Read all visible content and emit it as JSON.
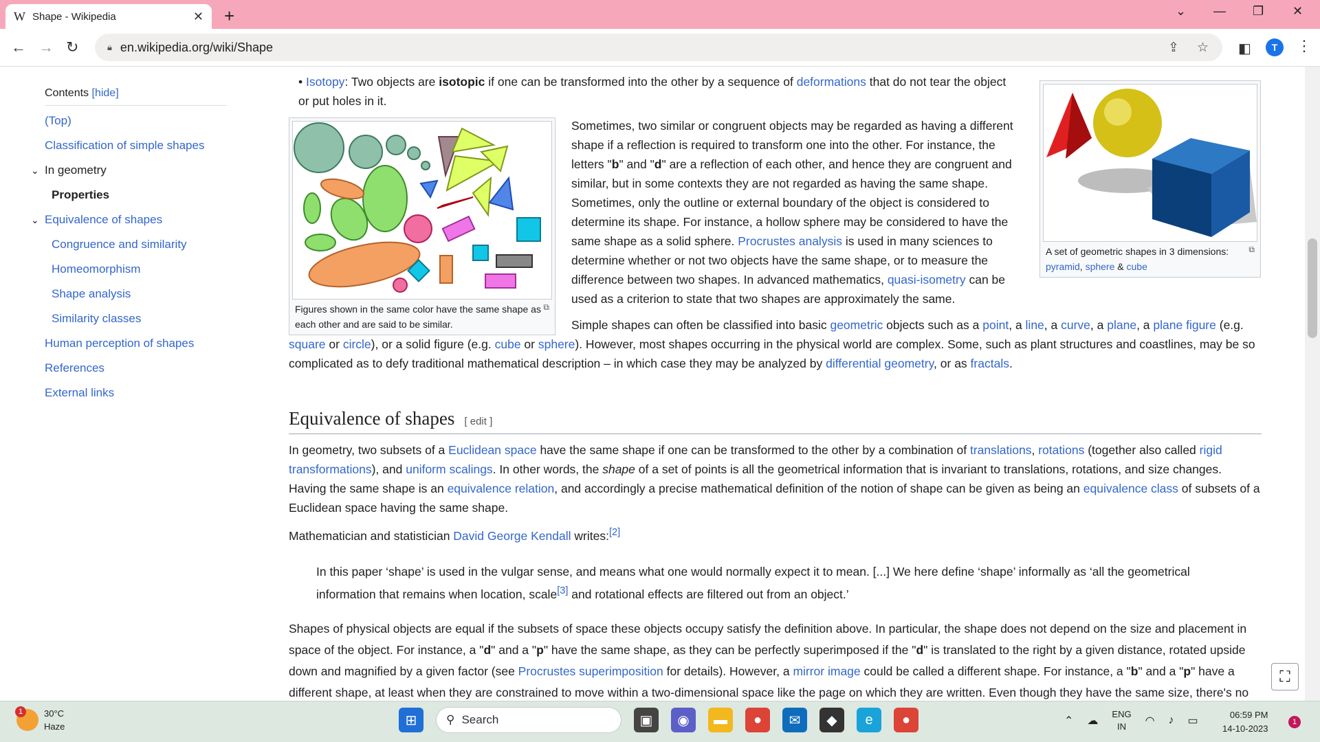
{
  "browser": {
    "tab_title": "Shape - Wikipedia",
    "tab_icon": "W",
    "url": "en.wikipedia.org/wiki/Shape",
    "profile_initial": "T",
    "accent": "#f6a8ba"
  },
  "toc": {
    "heading": "Contents",
    "hide": "[hide]",
    "items": [
      {
        "label": "(Top)"
      },
      {
        "label": "Classification of simple shapes"
      },
      {
        "label": "In geometry"
      },
      {
        "label": "Properties"
      },
      {
        "label": "Equivalence of shapes"
      },
      {
        "label": "Congruence and similarity"
      },
      {
        "label": "Homeomorphism"
      },
      {
        "label": "Shape analysis"
      },
      {
        "label": "Similarity classes"
      },
      {
        "label": "Human perception of shapes"
      },
      {
        "label": "References"
      },
      {
        "label": "External links"
      }
    ]
  },
  "article": {
    "isotopy": {
      "link": "Isotopy",
      "t1": ": Two objects are ",
      "bold": "isotopic",
      "t2": " if one can be transformed into the other by a sequence of ",
      "link2": "deformations",
      "t3": " that do not tear the object or put holes in it."
    },
    "fig_left_caption": "Figures shown in the same color have the same shape as each other and are said to be similar.",
    "fig_right_caption": "A set of geometric shapes in 3 dimensions: ",
    "fig_right_links": [
      "pyramid",
      "sphere",
      "cube"
    ],
    "fig_right_amp": " & ",
    "fig_right_comma": ", ",
    "p1a": "Sometimes, two similar or congruent objects may be regarded as having a different shape if a reflection is required to transform one into the other. For instance, the letters \"",
    "p1b": "b",
    "p1c": "\" and \"",
    "p1d": "d",
    "p1e": "\" are a reflection of each other, and hence they are congruent and similar, but in some contexts they are not regarded as having the same shape. Sometimes, only the outline or external boundary of the object is considered to determine its shape. For instance, a hollow sphere may be considered to have the same shape as a solid sphere. ",
    "p1_link1": "Procrustes analysis",
    "p1f": " is used in many sciences to determine whether or not two objects have the same shape, or to measure the difference between two shapes. In advanced mathematics, ",
    "p1_link2": "quasi-isometry",
    "p1g": " can be used as a criterion to state that two shapes are approximately the same.",
    "p2a": "Simple shapes can often be classified into basic ",
    "p2_links": [
      "geometric",
      "point",
      "line",
      "curve",
      "plane",
      "plane figure",
      "square",
      "circle",
      "cube",
      "sphere",
      "differential geometry",
      "fractals"
    ],
    "p2_t1": " objects such as a ",
    "p2_t2": ", a ",
    "p2_t3": " (e.g. ",
    "p2_t4": " or ",
    "p2_t5": "), or a solid figure (e.g. ",
    "p2_t6": "). However, most shapes occurring in the physical world are complex. Some, such as plant structures and coastlines, may be so complicated as to defy traditional mathematical description – in which case they may be analyzed by ",
    "p2_t7": ", or as ",
    "p2_t8": ".",
    "h2": "Equivalence of shapes",
    "h2_edit": "[ edit ]",
    "p3a": "In geometry, two subsets of a ",
    "p3_links": [
      "Euclidean space",
      "translations",
      "rotations",
      "rigid transformations",
      "uniform scalings",
      "equivalence relation",
      "equivalence class"
    ],
    "p3_t1": " have the same shape if one can be transformed to the other by a combination of ",
    "p3_t2": ", ",
    "p3_t3": " (together also called ",
    "p3_t4": "), and ",
    "p3_t5": ". In other words, the ",
    "p3_italic": "shape",
    "p3_t6": " of a set of points is all the geometrical information that is invariant to translations, rotations, and size changes. Having the same shape is an ",
    "p3_t7": ", and accordingly a precise mathematical definition of the notion of shape can be given as being an ",
    "p3_t8": " of subsets of a Euclidean space having the same shape.",
    "p4a": "Mathematician and statistician ",
    "p4_link": "David George Kendall",
    "p4b": " writes:",
    "p4_ref": "[2]",
    "quote_a": "In this paper ‘shape’ is used in the vulgar sense, and means what one would normally expect it to mean. [...] We here define ‘shape’ informally as ‘all the geometrical information that remains when location, scale",
    "quote_ref": "[3]",
    "quote_b": " and rotational effects are filtered out from an object.’",
    "p5a": "Shapes of physical objects are equal if the subsets of space these objects occupy satisfy the definition above. In particular, the shape does not depend on the size and placement in space of the object. For instance, a \"",
    "p5_d": "d",
    "p5b": "\" and a \"",
    "p5_p": "p",
    "p5c": "\" have the same shape, as they can be perfectly superimposed if the \"",
    "p5_d2": "d",
    "p5d": "\" is translated to the right by a given distance, rotated upside down and magnified by a given factor (see ",
    "p5_link1": "Procrustes superimposition",
    "p5e": " for details). However, a ",
    "p5_link2": "mirror image",
    "p5f": " could be called a different shape. For instance, a \"",
    "p5_b": "b",
    "p5g": "\" and a \"",
    "p5_p2": "p",
    "p5h": "\" have a different shape, at least when they are constrained to move within a two-dimensional space like the page on which they are written. Even though they have the same size, there's no"
  },
  "taskbar": {
    "temp": "30°C",
    "weather": "Haze",
    "weather_badge": "1",
    "search": "Search",
    "lang1": "ENG",
    "lang2": "IN",
    "time": "06:59 PM",
    "date": "14-10-2023",
    "notif": "1"
  }
}
